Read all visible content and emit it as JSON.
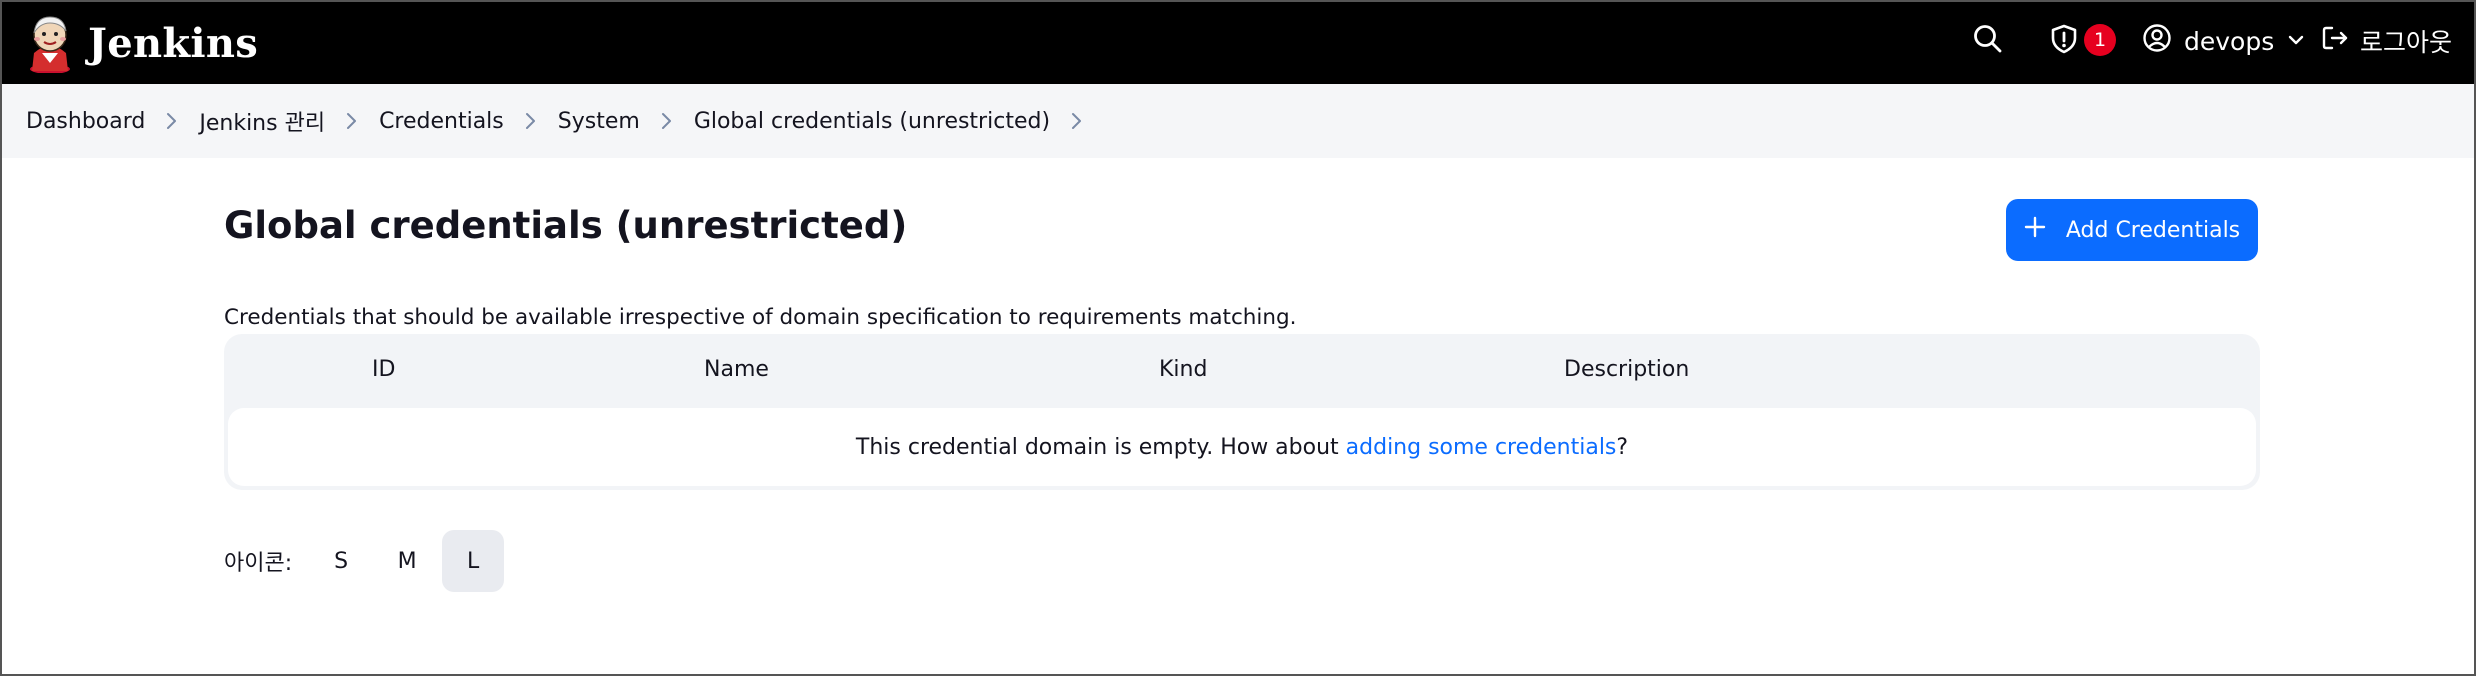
{
  "header": {
    "brand": "Jenkins",
    "alerts_count": "1",
    "user_name": "devops",
    "logout_label": "로그아웃"
  },
  "breadcrumbs": [
    "Dashboard",
    "Jenkins 관리",
    "Credentials",
    "System",
    "Global credentials (unrestricted)"
  ],
  "main": {
    "title": "Global credentials (unrestricted)",
    "add_button_label": "Add Credentials",
    "description": "Credentials that should be available irrespective of domain specification to requirements matching.",
    "table": {
      "columns": [
        "ID",
        "Name",
        "Kind",
        "Description"
      ],
      "empty_text": "This credential domain is empty. How about ",
      "empty_link": "adding some credentials",
      "empty_suffix": "?"
    },
    "icon_size": {
      "label": "아이콘:",
      "options": [
        "S",
        "M",
        "L"
      ],
      "selected": "L"
    }
  },
  "colors": {
    "header_bg": "#000000",
    "accent": "#0b6cff",
    "badge": "#e6001f"
  },
  "icons": [
    "jenkins-logo-icon",
    "search-icon",
    "shield-alert-icon",
    "user-circle-icon",
    "chevron-down-icon",
    "logout-icon",
    "chevron-right-icon",
    "plus-icon"
  ]
}
